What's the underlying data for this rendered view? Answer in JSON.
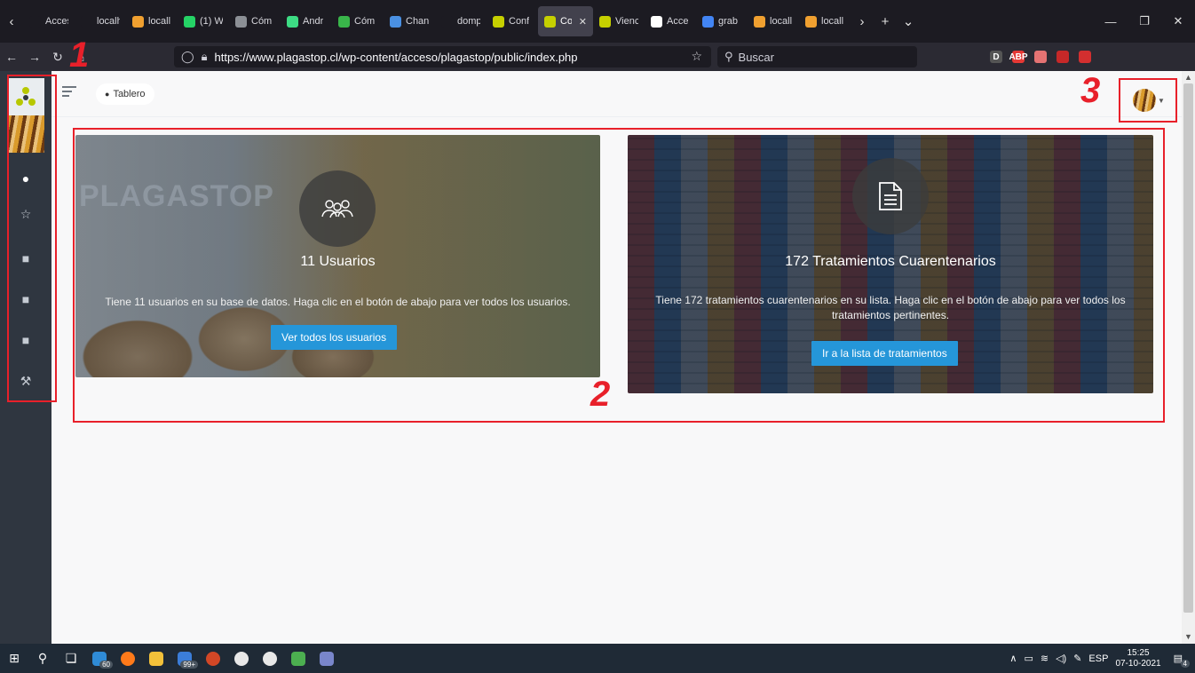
{
  "browser": {
    "tabs": [
      {
        "label": "Acceso F",
        "color": "#1c1b22",
        "active": false
      },
      {
        "label": "localhost",
        "color": "#1c1b22",
        "active": false
      },
      {
        "label": "locall",
        "color": "#f0a030",
        "active": false
      },
      {
        "label": "(1) W",
        "color": "#25d366",
        "active": false
      },
      {
        "label": "Cóm",
        "color": "#8c9096",
        "active": false
      },
      {
        "label": "Andr",
        "color": "#3ddc84",
        "active": false
      },
      {
        "label": "Cóm",
        "color": "#39b54a",
        "active": false
      },
      {
        "label": "Chan",
        "color": "#4a90e2",
        "active": false
      },
      {
        "label": "dompdf",
        "color": "#1c1b22",
        "active": false
      },
      {
        "label": "Conf",
        "color": "#c6d000",
        "active": false
      },
      {
        "label": "Co",
        "color": "#c6d000",
        "active": true
      },
      {
        "label": "Vienc",
        "color": "#c6d000",
        "active": false
      },
      {
        "label": "Acce",
        "color": "#ffffff",
        "active": false
      },
      {
        "label": "grab",
        "color": "#4285f4",
        "active": false
      },
      {
        "label": "locall",
        "color": "#f0a030",
        "active": false
      },
      {
        "label": "locall",
        "color": "#f0a030",
        "active": false
      }
    ],
    "url": "https://www.plagastop.cl/wp-content/acceso/plagastop/public/index.php",
    "search_placeholder": "Buscar",
    "extensions": [
      {
        "label": "",
        "color": "#2b2a33"
      },
      {
        "label": "D",
        "color": "#555555"
      },
      {
        "label": "ABP",
        "color": "#e53935"
      },
      {
        "label": "",
        "color": "#e57373"
      },
      {
        "label": "",
        "color": "#c62828"
      },
      {
        "label": "",
        "color": "#d32f2f"
      },
      {
        "label": "",
        "color": "#2b2a33"
      }
    ]
  },
  "app": {
    "breadcrumb": "Tablero",
    "sidebar_icons": [
      "bus-icon",
      "star-icon",
      "folder-icon",
      "folder-icon",
      "folder-icon",
      "tools-icon"
    ],
    "cards": [
      {
        "title": "11 Usuarios",
        "description": "Tiene 11 usuarios en su base de datos. Haga clic en el botón de abajo para ver todos los usuarios.",
        "button": "Ver todos los usuarios",
        "icon": "users-icon"
      },
      {
        "title": "172 Tratamientos Cuarentenarios",
        "description": "Tiene 172 tratamientos cuarentenarios en su lista. Haga clic en el botón de abajo para ver todos los tratamientos pertinentes.",
        "button": "Ir a la lista de tratamientos",
        "icon": "document-icon"
      }
    ],
    "watermark": "PLAGASTOP"
  },
  "annotations": [
    "1",
    "2",
    "3"
  ],
  "taskbar": {
    "badge_a": "60",
    "badge_b": "99+",
    "lang": "ESP",
    "time": "15:25",
    "date": "07-10-2021",
    "notif": "4"
  },
  "colors": {
    "accent_button": "#2596d9",
    "annotation": "#e8202a",
    "sidebar": "#2f3640"
  }
}
